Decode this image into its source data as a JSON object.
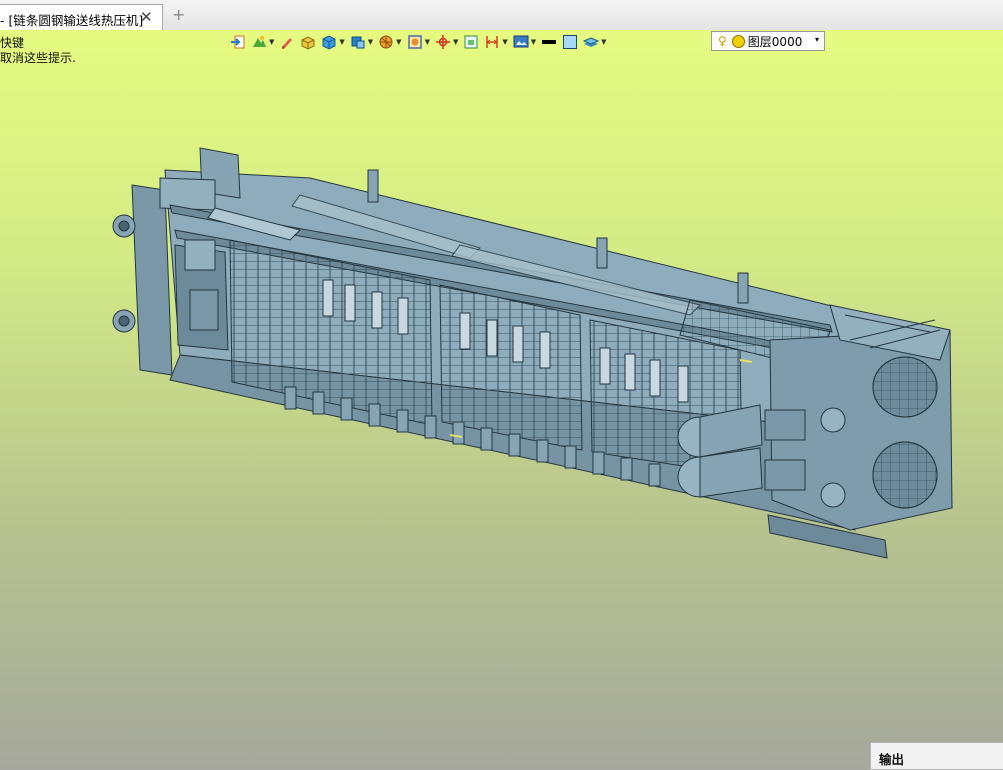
{
  "tab": {
    "title": "- [链条圆钢输送线热压机]",
    "close_glyph": "✕",
    "add_glyph": "+"
  },
  "hint": {
    "line1": "快键",
    "line2": "取消这些提示."
  },
  "toolbar": {
    "icons": [
      "import-icon",
      "scene-icon",
      "pen-icon",
      "solid-yellow-icon",
      "box-blue-icon",
      "box-view-icon",
      "sphere-icon",
      "frame-icon",
      "axis-icon",
      "fit-view-icon",
      "dimension-icon",
      "render-icon",
      "line-color-icon",
      "fill-color-icon",
      "layer-icon"
    ],
    "layer_value": "图层0000",
    "dropdown_glyph": "▾"
  },
  "output": {
    "title": "输出"
  },
  "colors": {
    "model_fill": "#86a4b4",
    "model_edge": "#24363f",
    "viewport_top": "#e6fb80",
    "viewport_bottom": "#a6a89d"
  }
}
